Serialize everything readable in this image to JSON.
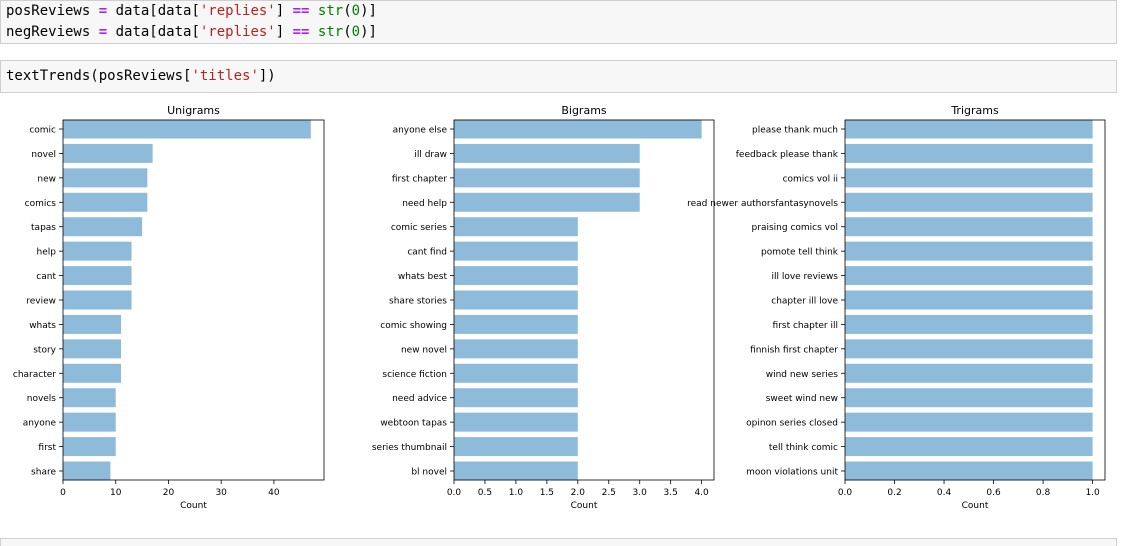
{
  "code_cell_1": {
    "line1": {
      "p1": "posReviews ",
      "op1": "=",
      "p2": " data[data[",
      "s1": "'replies'",
      "p3": "] ",
      "op2": "==",
      "p4": " ",
      "fn": "str",
      "p5": "(",
      "num": "0",
      "p6": ")]"
    },
    "line2": {
      "p1": "negReviews ",
      "op1": "=",
      "p2": " data[data[",
      "s1": "'replies'",
      "p3": "] ",
      "op2": "==",
      "p4": " ",
      "fn": "str",
      "p5": "(",
      "num": "0",
      "p6": ")]"
    }
  },
  "code_cell_2": {
    "line1": {
      "p1": "textTrends(posReviews[",
      "s1": "'titles'",
      "p2": "])"
    }
  },
  "colors": {
    "bar": "#8fbbdb",
    "code_op": "#aa22ff",
    "code_str": "#ba2121",
    "code_num": "#008000"
  },
  "chart_data": [
    {
      "type": "bar",
      "orientation": "horizontal",
      "title": "Unigrams",
      "xlabel": "Count",
      "ylabel": "",
      "categories": [
        "comic",
        "novel",
        "new",
        "comics",
        "tapas",
        "help",
        "cant",
        "review",
        "whats",
        "story",
        "character",
        "novels",
        "anyone",
        "first",
        "share"
      ],
      "values": [
        47,
        17,
        16,
        16,
        15,
        13,
        13,
        13,
        11,
        11,
        11,
        10,
        10,
        10,
        9
      ],
      "xlim": [
        0,
        49.5
      ],
      "xticks": [
        0,
        10,
        20,
        30,
        40
      ],
      "xticklabels": [
        "0",
        "10",
        "20",
        "30",
        "40"
      ],
      "grid": false
    },
    {
      "type": "bar",
      "orientation": "horizontal",
      "title": "Bigrams",
      "xlabel": "Count",
      "ylabel": "",
      "categories": [
        "anyone else",
        "ill draw",
        "first chapter",
        "need help",
        "comic series",
        "cant find",
        "whats best",
        "share stories",
        "comic showing",
        "new novel",
        "science fiction",
        "need advice",
        "webtoon tapas",
        "series thumbnail",
        "bl novel"
      ],
      "values": [
        4,
        3,
        3,
        3,
        2,
        2,
        2,
        2,
        2,
        2,
        2,
        2,
        2,
        2,
        2
      ],
      "xlim": [
        0,
        4.2
      ],
      "xticks": [
        0,
        0.5,
        1,
        1.5,
        2,
        2.5,
        3,
        3.5,
        4
      ],
      "xticklabels": [
        "0.0",
        "0.5",
        "1.0",
        "1.5",
        "2.0",
        "2.5",
        "3.0",
        "3.5",
        "4.0"
      ],
      "grid": false
    },
    {
      "type": "bar",
      "orientation": "horizontal",
      "title": "Trigrams",
      "xlabel": "Count",
      "ylabel": "",
      "categories": [
        "please thank much",
        "feedback please thank",
        "comics vol ii",
        "read newer authorsfantasynovels",
        "praising comics vol",
        "pomote tell think",
        "ill love reviews",
        "chapter ill love",
        "first chapter ill",
        "finnish first chapter",
        "wind new series",
        "sweet wind new",
        "opinon series closed",
        "tell think comic",
        "moon violations unit"
      ],
      "values": [
        1,
        1,
        1,
        1,
        1,
        1,
        1,
        1,
        1,
        1,
        1,
        1,
        1,
        1,
        1
      ],
      "xlim": [
        0,
        1.05
      ],
      "xticks": [
        0,
        0.2,
        0.4,
        0.6,
        0.8,
        1.0
      ],
      "xticklabels": [
        "0.0",
        "0.2",
        "0.4",
        "0.6",
        "0.8",
        "1.0"
      ],
      "grid": false
    }
  ]
}
